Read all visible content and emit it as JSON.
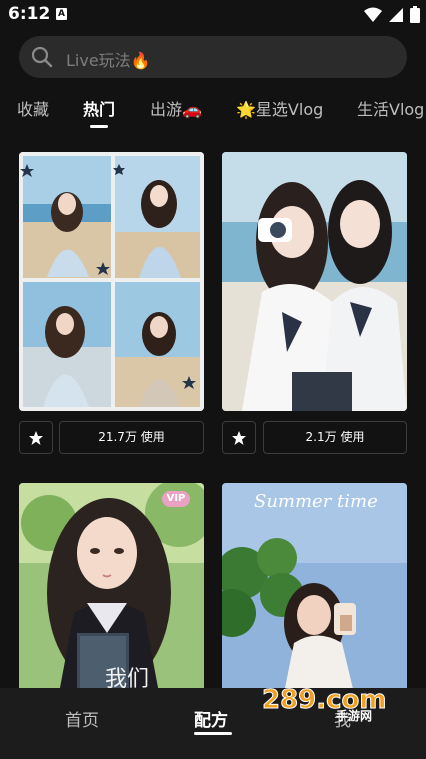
{
  "status_bar": {
    "time": "6:12",
    "notification_letter": "A"
  },
  "search": {
    "placeholder": "Live玩法🔥"
  },
  "tabs": [
    {
      "label": "收藏",
      "active": false
    },
    {
      "label": "热门",
      "active": true
    },
    {
      "label": "出游🚗",
      "active": false
    },
    {
      "label": "🌟星选Vlog",
      "active": false
    },
    {
      "label": "生活Vlog",
      "active": false
    }
  ],
  "templates": [
    {
      "usage": "21.7万 使用",
      "vip": false,
      "overlay_text": ""
    },
    {
      "usage": "2.1万 使用",
      "vip": false,
      "overlay_text": ""
    },
    {
      "usage": "",
      "vip": true,
      "vip_label": "VIP",
      "overlay_text": "我们"
    },
    {
      "usage": "",
      "vip": false,
      "overlay_text": "Summer time"
    }
  ],
  "bottom_nav": [
    {
      "label": "首页",
      "active": false
    },
    {
      "label": "配方",
      "active": true
    },
    {
      "label": "我",
      "active": false
    }
  ],
  "watermark": {
    "text": "289.com",
    "subtext": "手游网"
  },
  "colors": {
    "background": "#121212",
    "search_bg": "#2b2b2b",
    "nav_bg": "#1c1c1c",
    "vip_badge": "#e9a2c2"
  }
}
